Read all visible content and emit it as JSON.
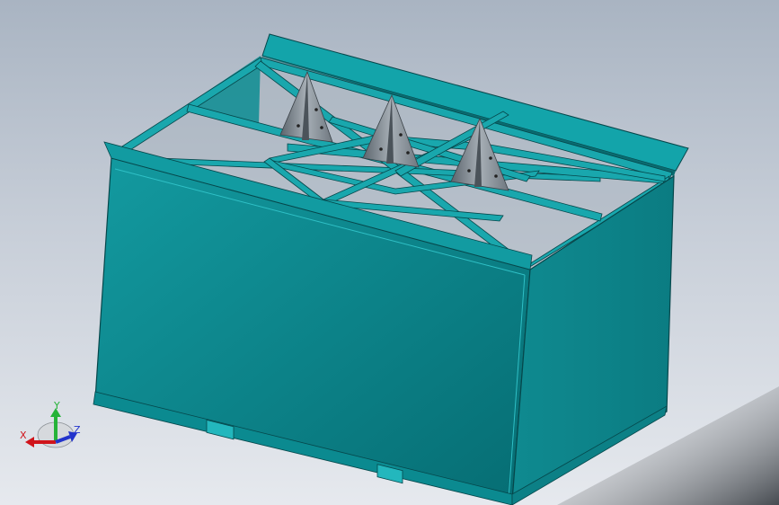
{
  "triad": {
    "x_label": "X",
    "y_label": "Y",
    "z_label": "Z"
  },
  "colors": {
    "panel_front": "#0a7f86",
    "panel_side": "#0e8d93",
    "frame_beam": "#19a7ad",
    "frame_edge": "#06474b",
    "bracket": "#7d8790",
    "axis_x": "#d0141b",
    "axis_y": "#25b338",
    "axis_z": "#2233cc"
  },
  "icons": {
    "triad": "coordinate-triad-icon"
  }
}
